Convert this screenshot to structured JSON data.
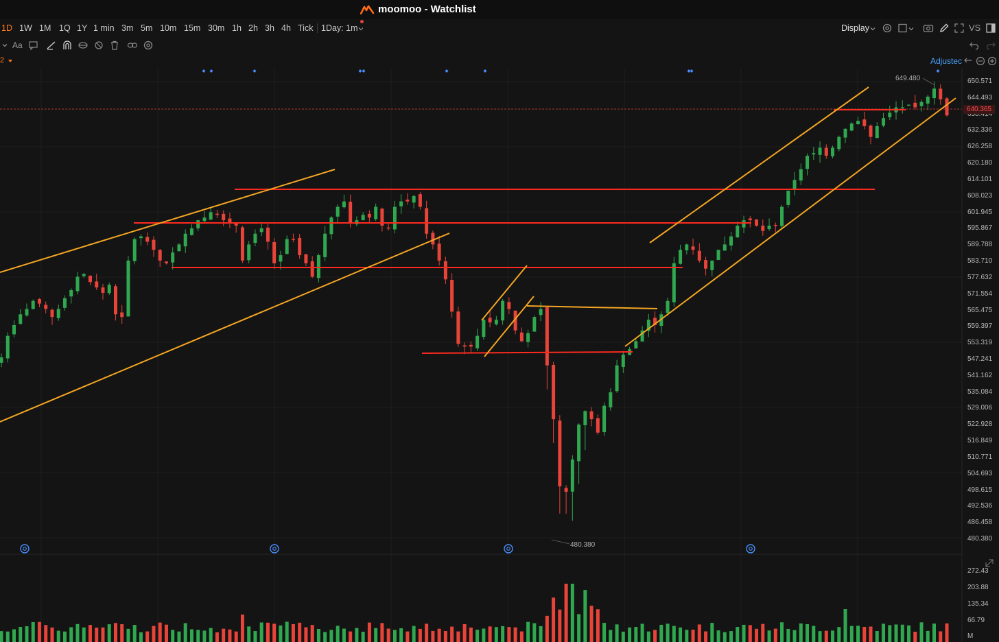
{
  "window": {
    "title": "moomoo - Watchlist"
  },
  "timeframes": [
    {
      "label": "1D",
      "active": true
    },
    {
      "label": "1W"
    },
    {
      "label": "1M"
    },
    {
      "label": "1Q"
    },
    {
      "label": "1Y"
    },
    {
      "label": "1 min"
    },
    {
      "label": "3m"
    },
    {
      "label": "5m"
    },
    {
      "label": "10m"
    },
    {
      "label": "15m"
    },
    {
      "label": "30m"
    },
    {
      "label": "1h"
    },
    {
      "label": "2h"
    },
    {
      "label": "3h"
    },
    {
      "label": "4h"
    },
    {
      "label": "Tick"
    },
    {
      "label": "1Day: 1m"
    }
  ],
  "toolbar": {
    "display_label": "Display",
    "vs_label": "VS",
    "font_label": "Aa",
    "icons": [
      "chevron-down-icon",
      "comment-icon",
      "trendline-icon",
      "magnet-icon",
      "eye-icon",
      "hide-icon",
      "trash-icon",
      "link-icon",
      "settings-icon"
    ]
  },
  "indicator_legend": {
    "label": "2"
  },
  "adjusted_label": "Adjustec",
  "price_axis": {
    "labels": [
      "650.571",
      "644.493",
      "638.414",
      "632.336",
      "626.258",
      "620.180",
      "614.101",
      "608.023",
      "601.945",
      "595.867",
      "589.788",
      "583.710",
      "577.632",
      "571.554",
      "565.475",
      "559.397",
      "553.319",
      "547.241",
      "541.162",
      "535.084",
      "529.006",
      "522.928",
      "516.849",
      "510.771",
      "504.693",
      "498.615",
      "492.536",
      "486.458",
      "480.380"
    ],
    "current_price": "640.365"
  },
  "annotations": {
    "high": "649.480",
    "low": "480.380"
  },
  "volume_axis": {
    "labels": [
      "272.43",
      "203.88",
      "135.34",
      "66.79"
    ],
    "unit": "M"
  },
  "colors": {
    "up": "#2fa84f",
    "down": "#e8443a",
    "trendline": "#f5a623",
    "level": "#ff2a1f",
    "accent": "#ff7a1a",
    "link": "#4aa3ff"
  },
  "chart_data": {
    "type": "candlestick",
    "title": "",
    "ylim": [
      480.38,
      650.571
    ],
    "levels": [
      608.9,
      596.8,
      582.0,
      549.1,
      640.4
    ],
    "close_series": [
      548,
      556,
      560,
      564,
      566,
      569,
      568,
      566,
      563,
      566,
      570,
      573,
      578,
      579,
      576,
      574,
      572,
      575,
      564,
      563,
      584,
      592,
      593,
      591,
      588,
      584,
      583,
      587,
      590,
      594,
      596,
      599,
      600,
      602,
      601,
      599,
      598,
      597,
      584,
      590,
      594,
      596,
      591,
      583,
      586,
      592,
      592,
      586,
      583,
      578,
      586,
      594,
      600,
      604,
      606,
      598,
      599,
      601,
      600,
      604,
      597,
      596,
      604,
      606,
      606,
      608,
      604,
      594,
      590,
      584,
      577,
      565,
      553,
      552,
      552,
      556,
      562,
      561,
      562,
      569,
      566,
      558,
      554,
      557,
      563,
      566,
      545,
      525,
      500,
      498,
      510,
      523,
      528,
      525,
      520,
      530,
      535,
      545,
      549,
      551,
      554,
      558,
      562,
      560,
      564,
      569,
      583,
      588,
      590,
      588,
      584,
      581,
      584,
      588,
      590,
      593,
      597,
      599,
      599,
      597,
      595,
      597,
      597,
      604,
      610,
      614,
      618,
      623,
      624,
      626,
      623,
      626,
      630,
      633,
      635,
      636,
      634,
      630,
      634,
      637,
      639,
      641,
      641,
      642,
      641,
      643,
      645,
      648,
      644,
      638
    ]
  }
}
